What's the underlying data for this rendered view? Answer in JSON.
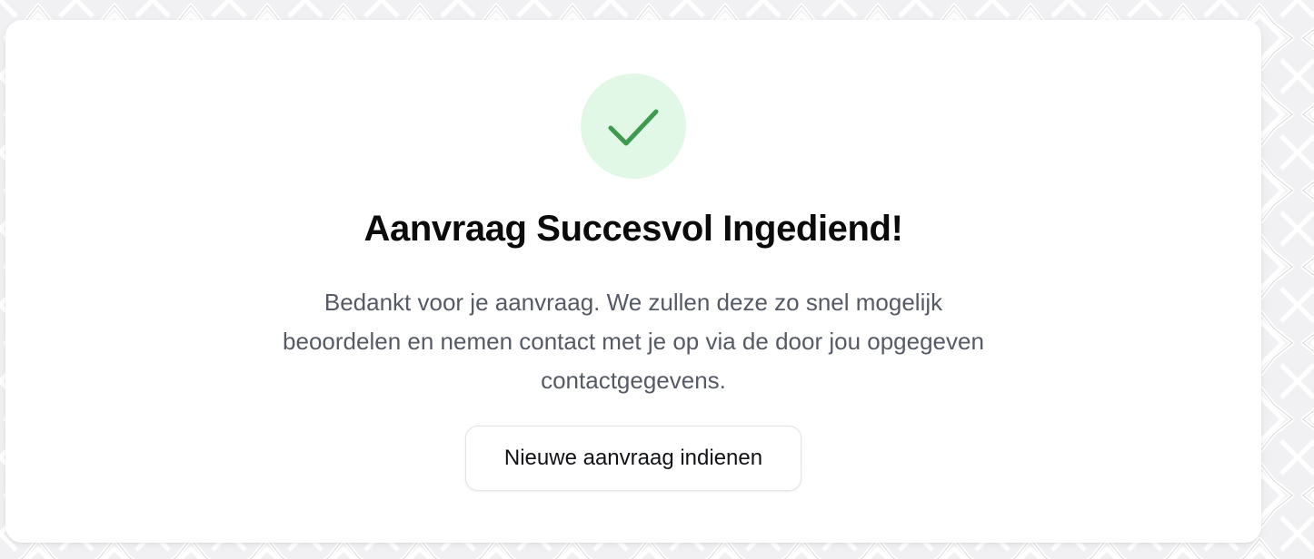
{
  "success": {
    "title": "Aanvraag Succesvol Ingediend!",
    "message": "Bedankt voor je aanvraag. We zullen deze zo snel mogelijk beoordelen en nemen contact met je op via de door jou opgegeven contactgegevens.",
    "button_label": "Nieuwe aanvraag indienen",
    "icon": "check-icon"
  },
  "colors": {
    "page_background": "#f3f3f4",
    "icon_circle_bg": "#e2f8e6",
    "icon_check": "#3e9a4f",
    "title_text": "#0b0b0c",
    "message_text": "#555a66",
    "button_text": "#111216"
  }
}
